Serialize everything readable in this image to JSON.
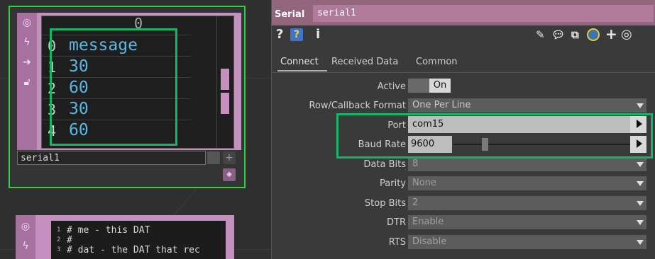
{
  "node1": {
    "sidebar_icons": [
      "target-icon",
      "lightning-icon",
      "arrow-right-icon",
      "lock-icon"
    ],
    "column_header": "0",
    "rows": [
      {
        "index": "0",
        "value": "message"
      },
      {
        "index": "1",
        "value": "30"
      },
      {
        "index": "2",
        "value": "60"
      },
      {
        "index": "3",
        "value": "30"
      },
      {
        "index": "4",
        "value": "60"
      }
    ],
    "name": "serial1"
  },
  "node2": {
    "lines": [
      {
        "num": "1",
        "text": "# me - this DAT"
      },
      {
        "num": "2",
        "text": "#"
      },
      {
        "num": "3",
        "text": "# dat - the DAT that rec"
      }
    ]
  },
  "panel": {
    "op_type": "Serial",
    "op_name": "serial1",
    "toolbar_left": [
      "?",
      "help-icon",
      "i"
    ],
    "toolbar_right": [
      "pencil-icon",
      "comment-icon",
      "clone-icon",
      "python-icon",
      "+",
      "target-icon"
    ],
    "tabs": [
      "Connect",
      "Received Data",
      "Common"
    ],
    "active_tab": "Connect",
    "params": {
      "active": {
        "label": "Active",
        "value": "On"
      },
      "row_callback": {
        "label": "Row/Callback Format",
        "value": "One Per Line"
      },
      "port": {
        "label": "Port",
        "value": "com15"
      },
      "baud_rate": {
        "label": "Baud Rate",
        "value": "9600"
      },
      "data_bits": {
        "label": "Data Bits",
        "value": "8"
      },
      "parity": {
        "label": "Parity",
        "value": "None"
      },
      "stop_bits": {
        "label": "Stop Bits",
        "value": "2"
      },
      "dtr": {
        "label": "DTR",
        "value": "Enable"
      },
      "rts": {
        "label": "RTS",
        "value": "Disable"
      }
    }
  },
  "colors": {
    "node_pink": "#c58fbf",
    "header_purple": "#93667e",
    "highlight_green": "#15b56a",
    "selection_green": "#2fd23a",
    "value_blue": "#5ab8e0"
  }
}
